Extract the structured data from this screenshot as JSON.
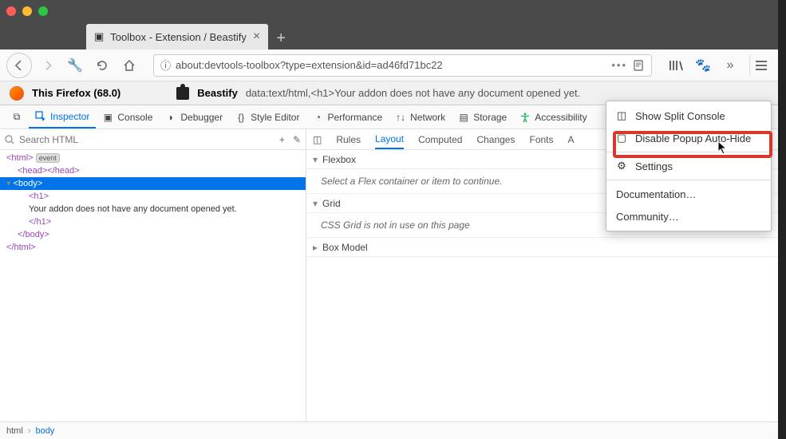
{
  "tab": {
    "title": "Toolbox - Extension / Beastify"
  },
  "url": "about:devtools-toolbox?type=extension&id=ad46fd71bc22",
  "infobar": {
    "firefox": "This Firefox (68.0)",
    "ext_name": "Beastify",
    "ext_text": "data:text/html,<h1>Your addon does not have any document opened yet."
  },
  "tools": {
    "inspector": "Inspector",
    "console": "Console",
    "debugger": "Debugger",
    "style": "Style Editor",
    "perf": "Performance",
    "network": "Network",
    "storage": "Storage",
    "a11y": "Accessibility"
  },
  "search_placeholder": "Search HTML",
  "dom": {
    "html_open": "<html>",
    "event": "event",
    "head": "<head></head>",
    "body_open": "<body>",
    "h1_open": "<h1>",
    "text": "Your addon does not have any document opened yet.",
    "h1_close": "</h1>",
    "body_close": "</body>",
    "html_close": "</html>"
  },
  "subtabs": {
    "rules": "Rules",
    "layout": "Layout",
    "computed": "Computed",
    "changes": "Changes",
    "fonts": "Fonts",
    "a": "A"
  },
  "sections": {
    "flexbox": "Flexbox",
    "flexbox_msg": "Select a Flex container or item to continue.",
    "grid": "Grid",
    "grid_msg": "CSS Grid is not in use on this page",
    "boxmodel": "Box Model"
  },
  "breadcrumb": {
    "html": "html",
    "body": "body"
  },
  "popup": {
    "split": "Show Split Console",
    "disable": "Disable Popup Auto-Hide",
    "settings": "Settings",
    "docs": "Documentation…",
    "community": "Community…"
  }
}
